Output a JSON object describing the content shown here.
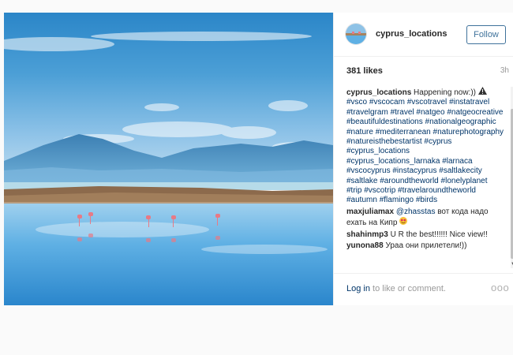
{
  "post": {
    "author": {
      "username": "cyprus_locations",
      "avatar_icon": "avatar-flamingo-lake"
    },
    "follow_label": "Follow",
    "likes": "381 likes",
    "time": "3h",
    "caption": {
      "text": "Happening now:))",
      "emoji": "warning-sign-icon",
      "hashtags": [
        "#vsco",
        "#vscocam",
        "#vscotravel",
        "#instatravel",
        "#travelgram",
        "#travel",
        "#natgeo",
        "#natgeocreative",
        "#beautifuldestinations",
        "#nationalgeographic",
        "#nature",
        "#mediterranean",
        "#naturephotography",
        "#natureisthebestartist",
        "#cyprus",
        "#cyprus_locations",
        "#cyprus_locations_larnaka",
        "#larnaca",
        "#vscocyprus",
        "#instacyprus",
        "#saltlakecity",
        "#saltlake",
        "#aroundtheworld",
        "#lonelyplanet",
        "#trip",
        "#vscotrip",
        "#travelaroundtheworld",
        "#autumn",
        "#flamingo",
        "#birds"
      ]
    },
    "comments": [
      {
        "user": "maxjuliamax",
        "mention": "@zhasstas",
        "text": "вот кода надо ехать на Кипр",
        "emoji": "heart-eyes-icon"
      },
      {
        "user": "shahinmp3",
        "text": "U R the best!!!!!! Nice view!!"
      },
      {
        "user": "yunona88",
        "text": "Ураа они прилетели!))"
      }
    ],
    "footer": {
      "login_label": "Log in",
      "rest": " to like or comment.",
      "more_label": "ooo"
    },
    "colors": {
      "link": "#003569",
      "follow": "#3f729b",
      "muted": "#999999"
    }
  }
}
